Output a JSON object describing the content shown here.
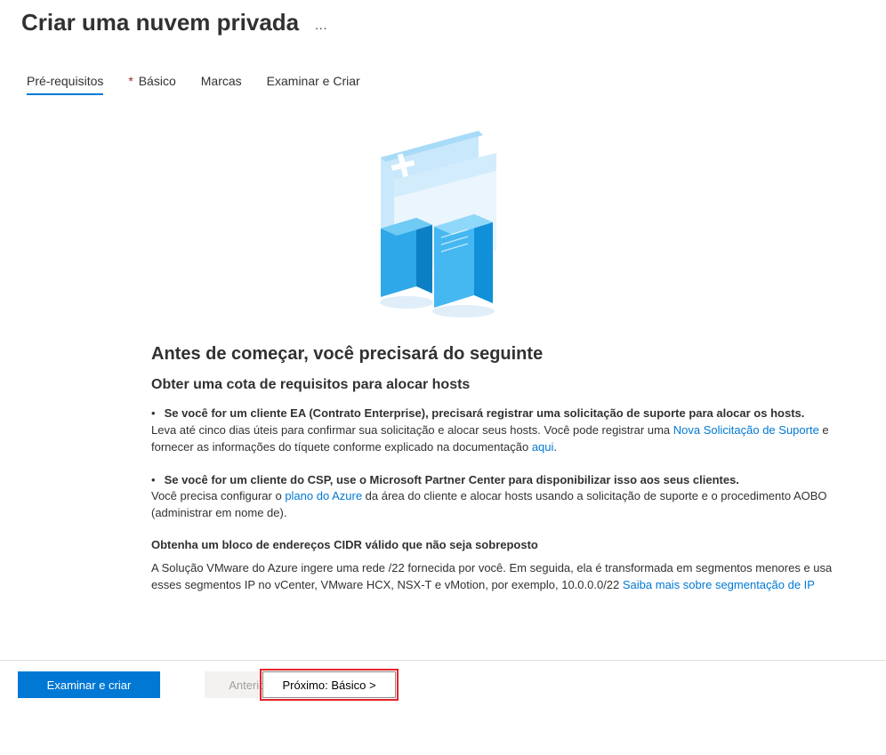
{
  "header": {
    "title": "Criar uma nuvem privada",
    "ellipsis": "···"
  },
  "tabs": {
    "prereq": "Pré-requisitos",
    "basic": "Básico",
    "tags": "Marcas",
    "review": "Examinar e Criar"
  },
  "content": {
    "section_title": "Antes de começar, você precisará do seguinte",
    "section_sub": "Obter uma cota de requisitos para alocar hosts",
    "bullet1_bold": "Se você for um cliente EA (Contrato Enterprise), precisará registrar uma solicitação de suporte para alocar os hosts.",
    "bullet1_text_a": "Leva até cinco dias úteis para confirmar sua solicitação e alocar seus hosts. Você pode registrar uma ",
    "bullet1_link1": "Nova Solicitação de Suporte",
    "bullet1_text_b": " e fornecer as informações do tíquete conforme explicado na documentação ",
    "bullet1_link2": "aqui",
    "bullet1_text_c": ".",
    "bullet2_bold": "Se você for um cliente do CSP, use o Microsoft Partner Center para disponibilizar isso aos seus clientes.",
    "bullet2_text_a": "Você precisa configurar o ",
    "bullet2_link1": "plano do Azure",
    "bullet2_text_b": " da área do cliente e alocar hosts usando a solicitação de suporte e o procedimento AOBO (administrar em nome de).",
    "cidr_heading": "Obtenha um bloco de endereços CIDR válido que não seja sobreposto",
    "cidr_text_a": "A Solução VMware do Azure ingere uma rede /22 fornecida por você. Em seguida, ela é transformada em segmentos menores e usa esses segmentos IP no vCenter, VMware HCX, NSX-T e vMotion, por exemplo, 10.0.0.0/22 ",
    "cidr_link": "Saiba mais sobre segmentação de IP"
  },
  "footer": {
    "review_create": "Examinar e criar",
    "previous": "Anterior",
    "next": "Próximo: Básico  >"
  }
}
